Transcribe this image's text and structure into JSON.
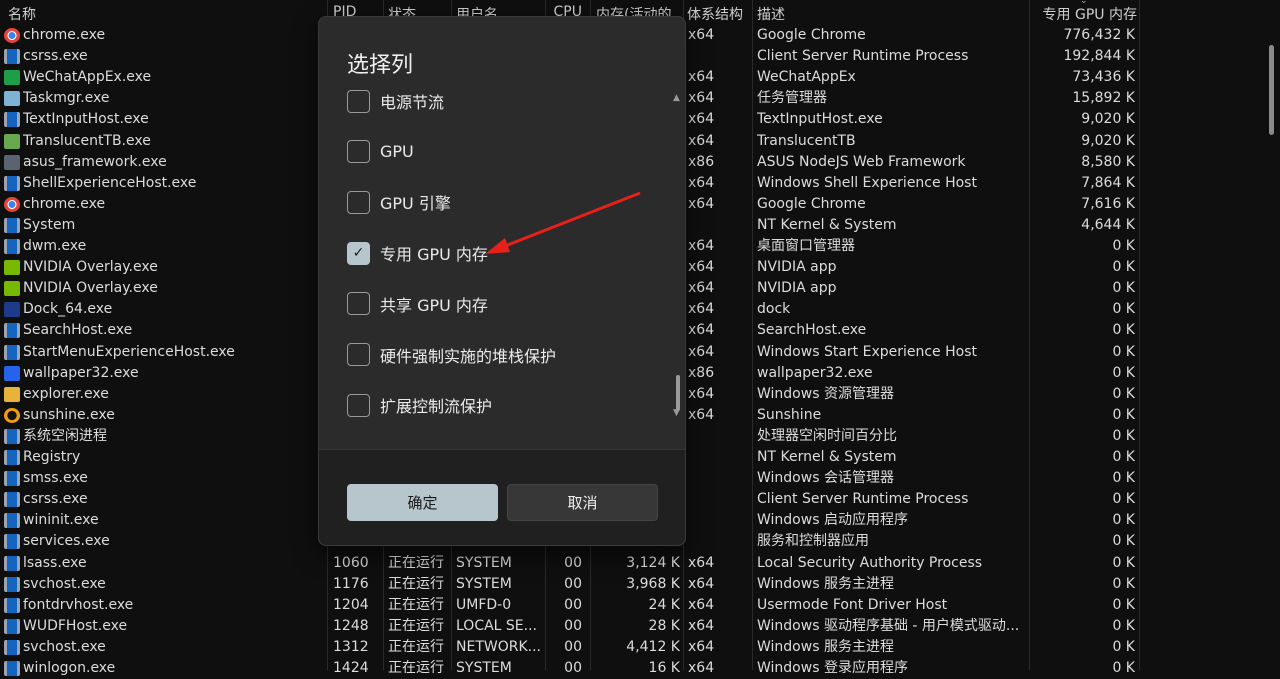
{
  "columns": {
    "name": "名称",
    "pid": "PID",
    "status": "状态",
    "user": "用户名",
    "cpu": "CPU",
    "mem": "内存(活动的",
    "arch": "体系结构",
    "desc": "描述",
    "gpu": "专用 GPU 内存"
  },
  "rows": [
    {
      "icon": "chrome-icon",
      "name": "chrome.exe",
      "pid": "",
      "status": "",
      "user": "",
      "cpu": "",
      "mem": "",
      "arch": "x64",
      "desc": "Google Chrome",
      "gpu": "776,432 K"
    },
    {
      "icon": "app-icon",
      "name": "csrss.exe",
      "pid": "",
      "status": "",
      "user": "",
      "cpu": "",
      "mem": "",
      "arch": "",
      "desc": "Client Server Runtime Process",
      "gpu": "192,844 K"
    },
    {
      "icon": "wechat-icon",
      "name": "WeChatAppEx.exe",
      "pid": "",
      "status": "",
      "user": "",
      "cpu": "",
      "mem": "",
      "arch": "x64",
      "desc": "WeChatAppEx",
      "gpu": "73,436 K"
    },
    {
      "icon": "taskmgr-icon",
      "name": "Taskmgr.exe",
      "pid": "",
      "status": "",
      "user": "",
      "cpu": "",
      "mem": "",
      "arch": "x64",
      "desc": "任务管理器",
      "gpu": "15,892 K"
    },
    {
      "icon": "app-icon",
      "name": "TextInputHost.exe",
      "pid": "",
      "status": "",
      "user": "",
      "cpu": "",
      "mem": "",
      "arch": "x64",
      "desc": "TextInputHost.exe",
      "gpu": "9,020 K"
    },
    {
      "icon": "translucenttb-icon",
      "name": "TranslucentTB.exe",
      "pid": "",
      "status": "",
      "user": "",
      "cpu": "",
      "mem": "",
      "arch": "x64",
      "desc": "TranslucentTB",
      "gpu": "9,020 K"
    },
    {
      "icon": "asus-icon",
      "name": "asus_framework.exe",
      "pid": "",
      "status": "",
      "user": "",
      "cpu": "",
      "mem": "",
      "arch": "x86",
      "desc": "ASUS NodeJS Web Framework",
      "gpu": "8,580 K"
    },
    {
      "icon": "app-icon",
      "name": "ShellExperienceHost.exe",
      "pid": "",
      "status": "",
      "user": "",
      "cpu": "",
      "mem": "",
      "arch": "x64",
      "desc": "Windows Shell Experience Host",
      "gpu": "7,864 K"
    },
    {
      "icon": "chrome-icon",
      "name": "chrome.exe",
      "pid": "",
      "status": "",
      "user": "",
      "cpu": "",
      "mem": "",
      "arch": "x64",
      "desc": "Google Chrome",
      "gpu": "7,616 K"
    },
    {
      "icon": "app-icon",
      "name": "System",
      "pid": "",
      "status": "",
      "user": "",
      "cpu": "",
      "mem": "",
      "arch": "",
      "desc": "NT Kernel & System",
      "gpu": "4,644 K"
    },
    {
      "icon": "app-icon",
      "name": "dwm.exe",
      "pid": "",
      "status": "",
      "user": "",
      "cpu": "",
      "mem": "",
      "arch": "x64",
      "desc": "桌面窗口管理器",
      "gpu": "0 K"
    },
    {
      "icon": "nvidia-icon",
      "name": "NVIDIA Overlay.exe",
      "pid": "",
      "status": "",
      "user": "",
      "cpu": "",
      "mem": "",
      "arch": "x64",
      "desc": "NVIDIA app",
      "gpu": "0 K"
    },
    {
      "icon": "nvidia-icon",
      "name": "NVIDIA Overlay.exe",
      "pid": "",
      "status": "",
      "user": "",
      "cpu": "",
      "mem": "",
      "arch": "x64",
      "desc": "NVIDIA app",
      "gpu": "0 K"
    },
    {
      "icon": "dock-icon",
      "name": "Dock_64.exe",
      "pid": "",
      "status": "",
      "user": "",
      "cpu": "",
      "mem": "",
      "arch": "x64",
      "desc": "dock",
      "gpu": "0 K"
    },
    {
      "icon": "app-icon",
      "name": "SearchHost.exe",
      "pid": "",
      "status": "",
      "user": "",
      "cpu": "",
      "mem": "",
      "arch": "x64",
      "desc": "SearchHost.exe",
      "gpu": "0 K"
    },
    {
      "icon": "app-icon",
      "name": "StartMenuExperienceHost.exe",
      "pid": "",
      "status": "",
      "user": "",
      "cpu": "",
      "mem": "",
      "arch": "x64",
      "desc": "Windows Start Experience Host",
      "gpu": "0 K"
    },
    {
      "icon": "wallpaper-icon",
      "name": "wallpaper32.exe",
      "pid": "",
      "status": "",
      "user": "",
      "cpu": "",
      "mem": "",
      "arch": "x86",
      "desc": "wallpaper32.exe",
      "gpu": "0 K"
    },
    {
      "icon": "folder-icon",
      "name": "explorer.exe",
      "pid": "",
      "status": "",
      "user": "",
      "cpu": "",
      "mem": "",
      "arch": "x64",
      "desc": "Windows 资源管理器",
      "gpu": "0 K"
    },
    {
      "icon": "sunshine-icon",
      "name": "sunshine.exe",
      "pid": "",
      "status": "",
      "user": "",
      "cpu": "",
      "mem": "",
      "arch": "x64",
      "desc": "Sunshine",
      "gpu": "0 K"
    },
    {
      "icon": "app-icon",
      "name": "系统空闲进程",
      "pid": "",
      "status": "",
      "user": "",
      "cpu": "",
      "mem": "",
      "arch": "",
      "desc": "处理器空闲时间百分比",
      "gpu": "0 K"
    },
    {
      "icon": "app-icon",
      "name": "Registry",
      "pid": "",
      "status": "",
      "user": "",
      "cpu": "",
      "mem": "",
      "arch": "",
      "desc": "NT Kernel & System",
      "gpu": "0 K"
    },
    {
      "icon": "app-icon",
      "name": "smss.exe",
      "pid": "",
      "status": "",
      "user": "",
      "cpu": "",
      "mem": "",
      "arch": "",
      "desc": "Windows 会话管理器",
      "gpu": "0 K"
    },
    {
      "icon": "app-icon",
      "name": "csrss.exe",
      "pid": "",
      "status": "",
      "user": "",
      "cpu": "",
      "mem": "",
      "arch": "",
      "desc": "Client Server Runtime Process",
      "gpu": "0 K"
    },
    {
      "icon": "app-icon",
      "name": "wininit.exe",
      "pid": "",
      "status": "",
      "user": "",
      "cpu": "",
      "mem": "",
      "arch": "",
      "desc": "Windows 启动应用程序",
      "gpu": "0 K"
    },
    {
      "icon": "app-icon",
      "name": "services.exe",
      "pid": "",
      "status": "",
      "user": "",
      "cpu": "",
      "mem": "",
      "arch": "",
      "desc": "服务和控制器应用",
      "gpu": "0 K"
    },
    {
      "icon": "app-icon",
      "name": "lsass.exe",
      "pid": "1060",
      "status": "正在运行",
      "user": "SYSTEM",
      "cpu": "00",
      "mem": "3,124 K",
      "arch": "x64",
      "desc": "Local Security Authority Process",
      "gpu": "0 K"
    },
    {
      "icon": "app-icon",
      "name": "svchost.exe",
      "pid": "1176",
      "status": "正在运行",
      "user": "SYSTEM",
      "cpu": "00",
      "mem": "3,968 K",
      "arch": "x64",
      "desc": "Windows 服务主进程",
      "gpu": "0 K"
    },
    {
      "icon": "app-icon",
      "name": "fontdrvhost.exe",
      "pid": "1204",
      "status": "正在运行",
      "user": "UMFD-0",
      "cpu": "00",
      "mem": "24 K",
      "arch": "x64",
      "desc": "Usermode Font Driver Host",
      "gpu": "0 K"
    },
    {
      "icon": "app-icon",
      "name": "WUDFHost.exe",
      "pid": "1248",
      "status": "正在运行",
      "user": "LOCAL SE...",
      "cpu": "00",
      "mem": "28 K",
      "arch": "x64",
      "desc": "Windows 驱动程序基础 - 用户模式驱动...",
      "gpu": "0 K"
    },
    {
      "icon": "app-icon",
      "name": "svchost.exe",
      "pid": "1312",
      "status": "正在运行",
      "user": "NETWORK...",
      "cpu": "00",
      "mem": "4,412 K",
      "arch": "x64",
      "desc": "Windows 服务主进程",
      "gpu": "0 K"
    },
    {
      "icon": "app-icon",
      "name": "winlogon.exe",
      "pid": "1424",
      "status": "正在运行",
      "user": "SYSTEM",
      "cpu": "00",
      "mem": "16 K",
      "arch": "x64",
      "desc": "Windows 登录应用程序",
      "gpu": "0 K"
    }
  ],
  "dialog": {
    "title": "选择列",
    "options": [
      {
        "label": "电源节流",
        "checked": false
      },
      {
        "label": "GPU",
        "checked": false
      },
      {
        "label": "GPU 引擎",
        "checked": false
      },
      {
        "label": "专用 GPU 内存",
        "checked": true
      },
      {
        "label": "共享 GPU 内存",
        "checked": false
      },
      {
        "label": "硬件强制实施的堆栈保护",
        "checked": false
      },
      {
        "label": "扩展控制流保护",
        "checked": false
      }
    ],
    "ok_label": "确定",
    "cancel_label": "取消",
    "check_glyph": "✓"
  },
  "colors": {
    "accent": "#b6c6cc",
    "annotation_arrow": "#e8201a"
  }
}
